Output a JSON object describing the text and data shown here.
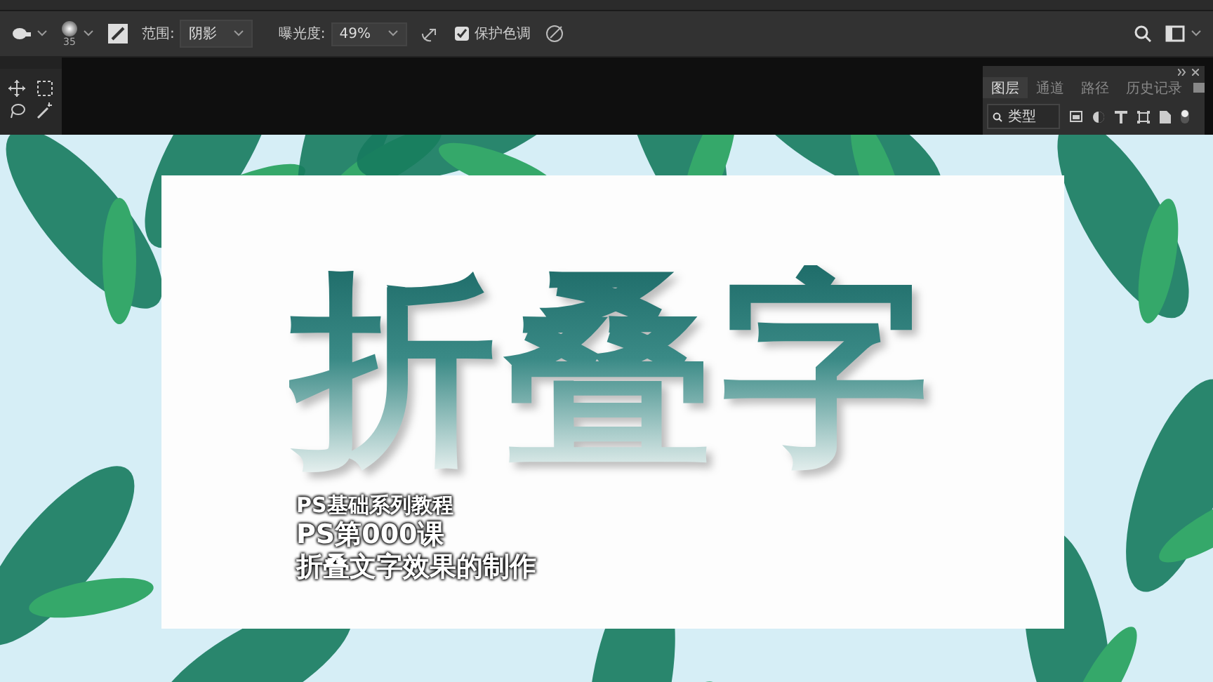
{
  "options_bar": {
    "brush_size": "35",
    "range_label": "范围:",
    "range_value": "阴影",
    "exposure_label": "曝光度:",
    "exposure_value": "49%",
    "protect_tones": {
      "label": "保护色调",
      "checked": true
    }
  },
  "layers_panel": {
    "tabs": [
      {
        "label": "图层",
        "selected": true
      },
      {
        "label": "通道",
        "selected": false
      },
      {
        "label": "路径",
        "selected": false
      },
      {
        "label": "历史记录",
        "selected": false
      }
    ],
    "filter": "类型"
  },
  "title_card": {
    "title": "折叠字",
    "series": "PS基础系列教程",
    "lesson": "PS第000课",
    "subtitle": "折叠文字效果的制作"
  }
}
